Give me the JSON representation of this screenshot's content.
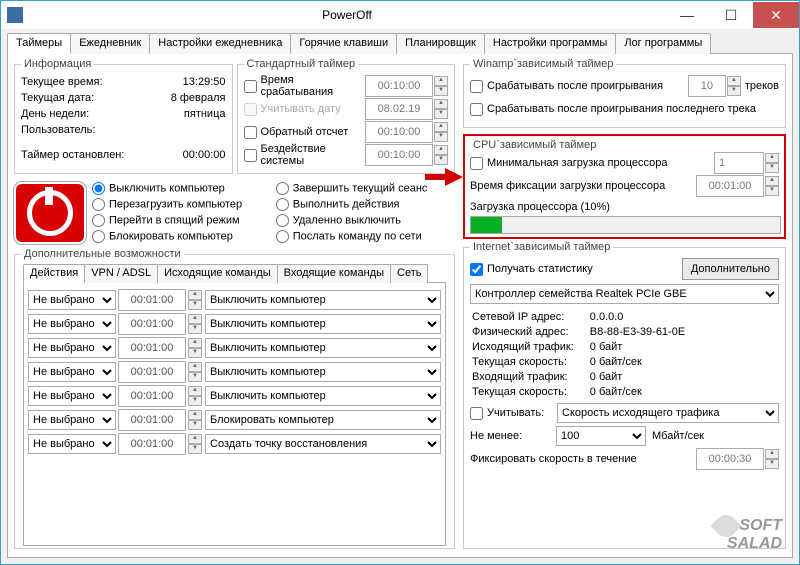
{
  "window": {
    "title": "PowerOff"
  },
  "tabs": [
    "Таймеры",
    "Ежедневник",
    "Настройки ежедневника",
    "Горячие клавиши",
    "Планировщик",
    "Настройки программы",
    "Лог программы"
  ],
  "info": {
    "legend": "Информация",
    "current_time_l": "Текущее время:",
    "current_time_v": "13:29:50",
    "current_date_l": "Текущая дата:",
    "current_date_v": "8 февраля",
    "weekday_l": "День недели:",
    "weekday_v": "пятница",
    "user_l": "Пользователь:",
    "user_v": "",
    "timer_l": "Таймер остановлен:",
    "timer_v": "00:00:00"
  },
  "std": {
    "legend": "Стандартный таймер",
    "trigger_time_l": "Время срабатывания",
    "trigger_time_v": "00:10:00",
    "use_date_l": "Учитывать дату",
    "use_date_v": "08.02.19",
    "countdown_l": "Обратный отсчет",
    "countdown_v": "00:10:00",
    "idle_l": "Бездействие системы",
    "idle_v": "00:10:00"
  },
  "actions": {
    "shutdown": "Выключить компьютер",
    "reboot": "Перезагрузить компьютер",
    "sleep": "Перейти в спящий режим",
    "lock": "Блокировать компьютер",
    "logoff": "Завершить текущий сеанс",
    "exec": "Выполнить действия",
    "remote_off": "Удаленно выключить",
    "netcmd": "Послать команду по сети"
  },
  "extra": {
    "legend": "Дополнительные возможности",
    "subtabs": [
      "Действия",
      "VPN / ADSL",
      "Исходящие команды",
      "Входящие команды",
      "Сеть"
    ],
    "none": "Не выбрано",
    "t": "00:01:00",
    "rows": [
      "Выключить компьютер",
      "Выключить компьютер",
      "Выключить компьютер",
      "Выключить компьютер",
      "Выключить компьютер",
      "Блокировать компьютер",
      "Создать точку восстановления"
    ]
  },
  "winamp": {
    "legend": "Winamp`зависимый таймер",
    "after_play_l": "Срабатывать после проигрывания",
    "tracks_v": "10",
    "tracks_l": "треков",
    "after_last_l": "Срабатывать после проигрывания последнего трека"
  },
  "cpu": {
    "legend": "CPU`зависимый таймер",
    "min_load_l": "Минимальная загрузка процессора",
    "min_load_v": "1",
    "fix_time_l": "Время фиксации загрузки процессора",
    "fix_time_v": "00:01:00",
    "load_l": "Загрузка процессора (10%)"
  },
  "net": {
    "legend": "Internet`зависимый таймер",
    "stats_cb": "Получать статистику",
    "advanced_btn": "Дополнительно",
    "adapter": "Контроллер семейства Realtek PCIe GBE",
    "ip_l": "Сетевой IP адрес:",
    "ip_v": "0.0.0.0",
    "mac_l": "Физический адрес:",
    "mac_v": "B8-88-E3-39-61-0E",
    "out_l": "Исходящий трафик:",
    "out_v": "0 байт",
    "speed_l": "Текущая скорость:",
    "speed_v": "0 байт/сек",
    "in_l": "Входящий трафик:",
    "in_v": "0 байт",
    "speed2_v": "0 байт/сек",
    "consider_l": "Учитывать:",
    "consider_v": "Скорость исходящего трафика",
    "min_l": "Не менее:",
    "min_v": "100",
    "min_unit": "Мбайт/сек",
    "fix_l": "Фиксировать скорость в течение",
    "fix_v": "00:00:30"
  },
  "watermark1": "SOFT",
  "watermark2": "SALAD"
}
